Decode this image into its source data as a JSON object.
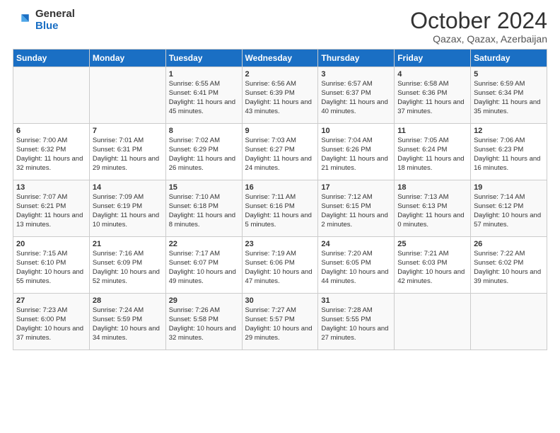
{
  "logo": {
    "general": "General",
    "blue": "Blue"
  },
  "title": "October 2024",
  "location": "Qazax, Qazax, Azerbaijan",
  "days_of_week": [
    "Sunday",
    "Monday",
    "Tuesday",
    "Wednesday",
    "Thursday",
    "Friday",
    "Saturday"
  ],
  "weeks": [
    [
      {
        "day": "",
        "sunrise": "",
        "sunset": "",
        "daylight": ""
      },
      {
        "day": "",
        "sunrise": "",
        "sunset": "",
        "daylight": ""
      },
      {
        "day": "1",
        "sunrise": "Sunrise: 6:55 AM",
        "sunset": "Sunset: 6:41 PM",
        "daylight": "Daylight: 11 hours and 45 minutes."
      },
      {
        "day": "2",
        "sunrise": "Sunrise: 6:56 AM",
        "sunset": "Sunset: 6:39 PM",
        "daylight": "Daylight: 11 hours and 43 minutes."
      },
      {
        "day": "3",
        "sunrise": "Sunrise: 6:57 AM",
        "sunset": "Sunset: 6:37 PM",
        "daylight": "Daylight: 11 hours and 40 minutes."
      },
      {
        "day": "4",
        "sunrise": "Sunrise: 6:58 AM",
        "sunset": "Sunset: 6:36 PM",
        "daylight": "Daylight: 11 hours and 37 minutes."
      },
      {
        "day": "5",
        "sunrise": "Sunrise: 6:59 AM",
        "sunset": "Sunset: 6:34 PM",
        "daylight": "Daylight: 11 hours and 35 minutes."
      }
    ],
    [
      {
        "day": "6",
        "sunrise": "Sunrise: 7:00 AM",
        "sunset": "Sunset: 6:32 PM",
        "daylight": "Daylight: 11 hours and 32 minutes."
      },
      {
        "day": "7",
        "sunrise": "Sunrise: 7:01 AM",
        "sunset": "Sunset: 6:31 PM",
        "daylight": "Daylight: 11 hours and 29 minutes."
      },
      {
        "day": "8",
        "sunrise": "Sunrise: 7:02 AM",
        "sunset": "Sunset: 6:29 PM",
        "daylight": "Daylight: 11 hours and 26 minutes."
      },
      {
        "day": "9",
        "sunrise": "Sunrise: 7:03 AM",
        "sunset": "Sunset: 6:27 PM",
        "daylight": "Daylight: 11 hours and 24 minutes."
      },
      {
        "day": "10",
        "sunrise": "Sunrise: 7:04 AM",
        "sunset": "Sunset: 6:26 PM",
        "daylight": "Daylight: 11 hours and 21 minutes."
      },
      {
        "day": "11",
        "sunrise": "Sunrise: 7:05 AM",
        "sunset": "Sunset: 6:24 PM",
        "daylight": "Daylight: 11 hours and 18 minutes."
      },
      {
        "day": "12",
        "sunrise": "Sunrise: 7:06 AM",
        "sunset": "Sunset: 6:23 PM",
        "daylight": "Daylight: 11 hours and 16 minutes."
      }
    ],
    [
      {
        "day": "13",
        "sunrise": "Sunrise: 7:07 AM",
        "sunset": "Sunset: 6:21 PM",
        "daylight": "Daylight: 11 hours and 13 minutes."
      },
      {
        "day": "14",
        "sunrise": "Sunrise: 7:09 AM",
        "sunset": "Sunset: 6:19 PM",
        "daylight": "Daylight: 11 hours and 10 minutes."
      },
      {
        "day": "15",
        "sunrise": "Sunrise: 7:10 AM",
        "sunset": "Sunset: 6:18 PM",
        "daylight": "Daylight: 11 hours and 8 minutes."
      },
      {
        "day": "16",
        "sunrise": "Sunrise: 7:11 AM",
        "sunset": "Sunset: 6:16 PM",
        "daylight": "Daylight: 11 hours and 5 minutes."
      },
      {
        "day": "17",
        "sunrise": "Sunrise: 7:12 AM",
        "sunset": "Sunset: 6:15 PM",
        "daylight": "Daylight: 11 hours and 2 minutes."
      },
      {
        "day": "18",
        "sunrise": "Sunrise: 7:13 AM",
        "sunset": "Sunset: 6:13 PM",
        "daylight": "Daylight: 11 hours and 0 minutes."
      },
      {
        "day": "19",
        "sunrise": "Sunrise: 7:14 AM",
        "sunset": "Sunset: 6:12 PM",
        "daylight": "Daylight: 10 hours and 57 minutes."
      }
    ],
    [
      {
        "day": "20",
        "sunrise": "Sunrise: 7:15 AM",
        "sunset": "Sunset: 6:10 PM",
        "daylight": "Daylight: 10 hours and 55 minutes."
      },
      {
        "day": "21",
        "sunrise": "Sunrise: 7:16 AM",
        "sunset": "Sunset: 6:09 PM",
        "daylight": "Daylight: 10 hours and 52 minutes."
      },
      {
        "day": "22",
        "sunrise": "Sunrise: 7:17 AM",
        "sunset": "Sunset: 6:07 PM",
        "daylight": "Daylight: 10 hours and 49 minutes."
      },
      {
        "day": "23",
        "sunrise": "Sunrise: 7:19 AM",
        "sunset": "Sunset: 6:06 PM",
        "daylight": "Daylight: 10 hours and 47 minutes."
      },
      {
        "day": "24",
        "sunrise": "Sunrise: 7:20 AM",
        "sunset": "Sunset: 6:05 PM",
        "daylight": "Daylight: 10 hours and 44 minutes."
      },
      {
        "day": "25",
        "sunrise": "Sunrise: 7:21 AM",
        "sunset": "Sunset: 6:03 PM",
        "daylight": "Daylight: 10 hours and 42 minutes."
      },
      {
        "day": "26",
        "sunrise": "Sunrise: 7:22 AM",
        "sunset": "Sunset: 6:02 PM",
        "daylight": "Daylight: 10 hours and 39 minutes."
      }
    ],
    [
      {
        "day": "27",
        "sunrise": "Sunrise: 7:23 AM",
        "sunset": "Sunset: 6:00 PM",
        "daylight": "Daylight: 10 hours and 37 minutes."
      },
      {
        "day": "28",
        "sunrise": "Sunrise: 7:24 AM",
        "sunset": "Sunset: 5:59 PM",
        "daylight": "Daylight: 10 hours and 34 minutes."
      },
      {
        "day": "29",
        "sunrise": "Sunrise: 7:26 AM",
        "sunset": "Sunset: 5:58 PM",
        "daylight": "Daylight: 10 hours and 32 minutes."
      },
      {
        "day": "30",
        "sunrise": "Sunrise: 7:27 AM",
        "sunset": "Sunset: 5:57 PM",
        "daylight": "Daylight: 10 hours and 29 minutes."
      },
      {
        "day": "31",
        "sunrise": "Sunrise: 7:28 AM",
        "sunset": "Sunset: 5:55 PM",
        "daylight": "Daylight: 10 hours and 27 minutes."
      },
      {
        "day": "",
        "sunrise": "",
        "sunset": "",
        "daylight": ""
      },
      {
        "day": "",
        "sunrise": "",
        "sunset": "",
        "daylight": ""
      }
    ]
  ]
}
